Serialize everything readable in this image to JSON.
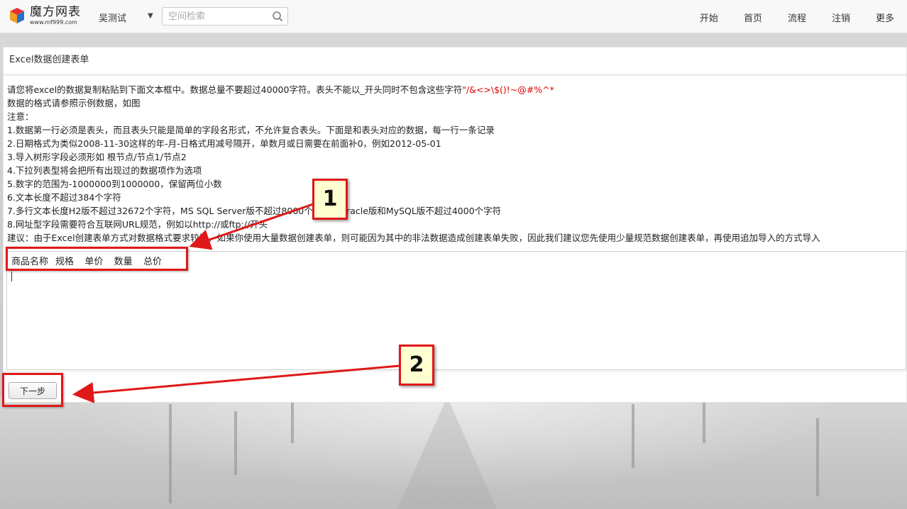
{
  "header": {
    "logo_title": "魔方网表",
    "logo_url": "www.mf999.com",
    "user_name": "吴测试",
    "user_caret": "▼",
    "search_placeholder": "空间检索",
    "nav": [
      "开始",
      "首页",
      "流程",
      "注销",
      "更多"
    ]
  },
  "panel": {
    "title": "Excel数据创建表单",
    "intro_text": "请您将excel的数据复制粘贴到下面文本框中。数据总量不要超过40000字符。表头不能以_开头同时不包含这些字符",
    "intro_chars": "\"/&<>\\$()!~@#%^*",
    "lines": [
      "数据的格式请参照示例数据，如图",
      "注意：",
      "1.数据第一行必须是表头，而且表头只能是简单的字段名形式，不允许复合表头。下面是和表头对应的数据，每一行一条记录",
      "2.日期格式为类似2008-11-30这样的年-月-日格式用减号隔开，单数月或日需要在前面补0，例如2012-05-01",
      "3.导入树形字段必须形如 根节点/节点1/节点2",
      "4.下拉列表型将会把所有出现过的数据项作为选项",
      "5.数字的范围为-1000000到1000000，保留两位小数",
      "6.文本长度不超过384个字符",
      "7.多行文本长度H2版不超过32672个字符，MS SQL Server版不超过8000个字符，Oracle版和MySQL版不超过4000个字符",
      "8.网址型字段需要符合互联网URL规范，例如以http://或ftp://开头",
      "建议：由于Excel创建表单方式对数据格式要求较严，如果你使用大量数据创建表单，则可能因为其中的非法数据造成创建表单失败，因此我们建议您先使用少量规范数据创建表单，再使用追加导入的方式导入"
    ],
    "data_header": "商品名称\t规格\t单价\t数量\t总价",
    "next_button": "下一步"
  },
  "annotations": {
    "badge1": "1",
    "badge2": "2",
    "color": "#e01818"
  }
}
